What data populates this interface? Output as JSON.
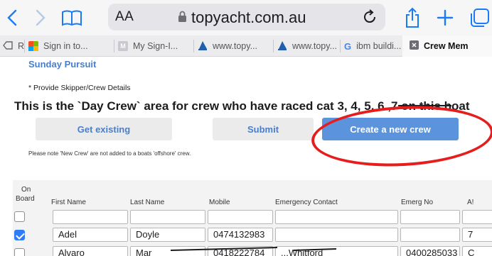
{
  "browser": {
    "text_size_label": "AA",
    "url": "topyacht.com.au",
    "accent": "#1a7cf5",
    "icons": [
      "back-icon",
      "forward-icon",
      "bookmarks-icon",
      "lock-icon",
      "reload-icon",
      "share-icon",
      "new-tab-icon",
      "tabs-icon"
    ]
  },
  "tabs": [
    {
      "label": "R",
      "favicon": "partial-tab-icon"
    },
    {
      "label": "Sign in to...",
      "favicon": "microsoft-icon"
    },
    {
      "label": "My Sign-I...",
      "favicon": "m-icon"
    },
    {
      "label": "www.topy...",
      "favicon": "sail-icon"
    },
    {
      "label": "www.topy...",
      "favicon": "sail-icon"
    },
    {
      "label": "ibm buildi...",
      "favicon": "google-icon"
    },
    {
      "label": "Crew Mem",
      "favicon": "close-tab-icon"
    }
  ],
  "page": {
    "boat_name": "Sunday Pursuit",
    "provide_details": "* Provide Skipper/Crew Details",
    "headline": "This is the `Day Crew` area for crew who have raced cat 3, 4, 5, 6 ,7 on this boat",
    "buttons": {
      "get_existing": "Get existing",
      "submit": "Submit",
      "create_new_crew": "Create a new crew"
    },
    "note": "Please note 'New Crew' are not added to a boats 'offshore' crew.",
    "colors": {
      "link": "#4a7ec9",
      "primary_button": "#5b93dc",
      "annotation": "#e61d1d"
    }
  },
  "table": {
    "headers": {
      "on": "On",
      "board": "Board",
      "first_name": "First Name",
      "last_name": "Last Name",
      "mobile": "Mobile",
      "emergency_contact": "Emergency Contact",
      "emerg_no": "Emerg No",
      "next": "A!"
    },
    "rows": [
      {
        "on_board": false,
        "first_name": "",
        "last_name": "",
        "mobile": "",
        "emergency_contact": "",
        "emerg_no": "",
        "next": ""
      },
      {
        "on_board": true,
        "first_name": "Adel",
        "last_name": "Doyle",
        "mobile": "0474132983",
        "emergency_contact": "",
        "emerg_no": "",
        "next": "7"
      },
      {
        "on_board": false,
        "first_name": "Alvaro",
        "last_name": "Mar",
        "mobile": "0418222784",
        "emergency_contact": "...Whitford",
        "emerg_no": "0400285033",
        "next": "C"
      }
    ]
  }
}
